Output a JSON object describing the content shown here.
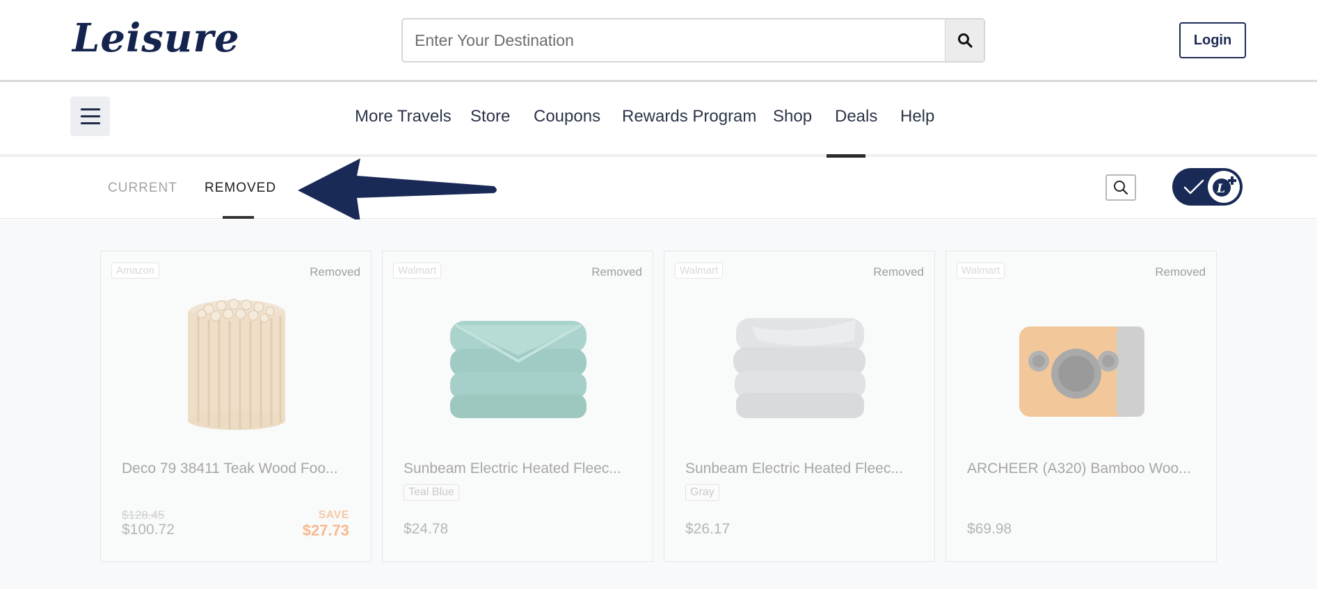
{
  "header": {
    "logo": "Leisure",
    "search_placeholder": "Enter Your Destination",
    "login_label": "Login"
  },
  "nav": {
    "items": [
      {
        "label": "More Travels"
      },
      {
        "label": "Store"
      },
      {
        "label": "Coupons"
      },
      {
        "label": "Rewards Program"
      },
      {
        "label": "Shop"
      },
      {
        "label": "Deals",
        "active": true
      },
      {
        "label": "Help"
      }
    ]
  },
  "subbar": {
    "tabs": [
      {
        "label": "CURRENT"
      },
      {
        "label": "REMOVED",
        "active": true
      }
    ],
    "arrow_color": "#1a2a57",
    "toggle_color": "#182a55"
  },
  "cards": [
    {
      "store": "Amazon",
      "status": "Removed",
      "title": "Deco 79 38411 Teak Wood Foo...",
      "old_price": "$128.45",
      "price": "$100.72",
      "save_label": "SAVE",
      "save_amount": "$27.73",
      "image": "teak-wood-stool"
    },
    {
      "store": "Walmart",
      "status": "Removed",
      "title": "Sunbeam Electric Heated Fleec...",
      "variant": "Teal Blue",
      "price": "$24.78",
      "image": "teal-blanket"
    },
    {
      "store": "Walmart",
      "status": "Removed",
      "title": "Sunbeam Electric Heated Fleec...",
      "variant": "Gray",
      "price": "$26.17",
      "image": "gray-blanket"
    },
    {
      "store": "Walmart",
      "status": "Removed",
      "title": "ARCHEER (A320) Bamboo Woo...",
      "price": "$69.98",
      "image": "bamboo-speaker"
    }
  ]
}
